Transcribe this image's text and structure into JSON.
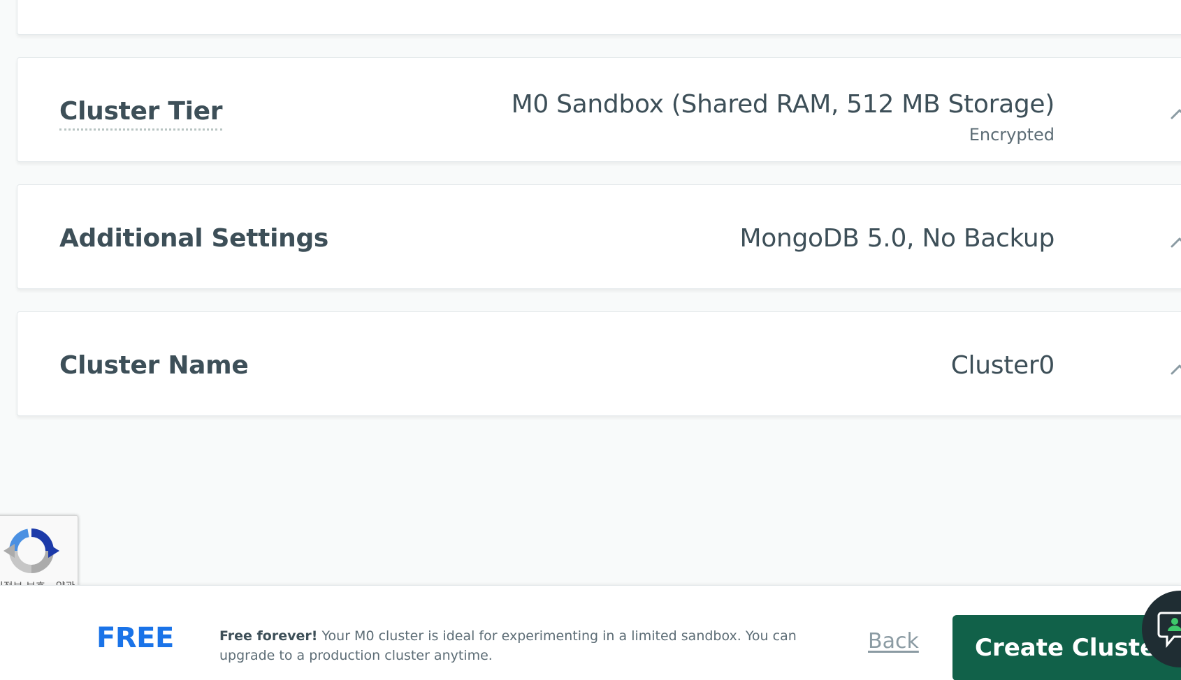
{
  "cluster_tier": {
    "title": "Cluster Tier",
    "value": "M0 Sandbox (Shared RAM, 512 MB Storage)",
    "sub": "Encrypted"
  },
  "additional_settings": {
    "title": "Additional Settings",
    "value": "MongoDB 5.0, No Backup"
  },
  "cluster_name": {
    "title": "Cluster Name",
    "value": "Cluster0"
  },
  "recaptcha": {
    "text": "인정보 보호 - 약관",
    "icon": "recaptcha-icon"
  },
  "footer": {
    "tier_label": "FREE",
    "message_bold": "Free forever!",
    "message": " Your M0 cluster is ideal for experimenting in a limited sandbox. You can upgrade to a production cluster anytime.",
    "back_label": "Back",
    "create_label": "Create Cluster"
  },
  "colors": {
    "accent_blue": "#1a73e8",
    "primary_green": "#116149",
    "text": "#3d4f58"
  },
  "icons": {
    "chevron": "chevron-up-icon",
    "chat": "chat-icon"
  }
}
